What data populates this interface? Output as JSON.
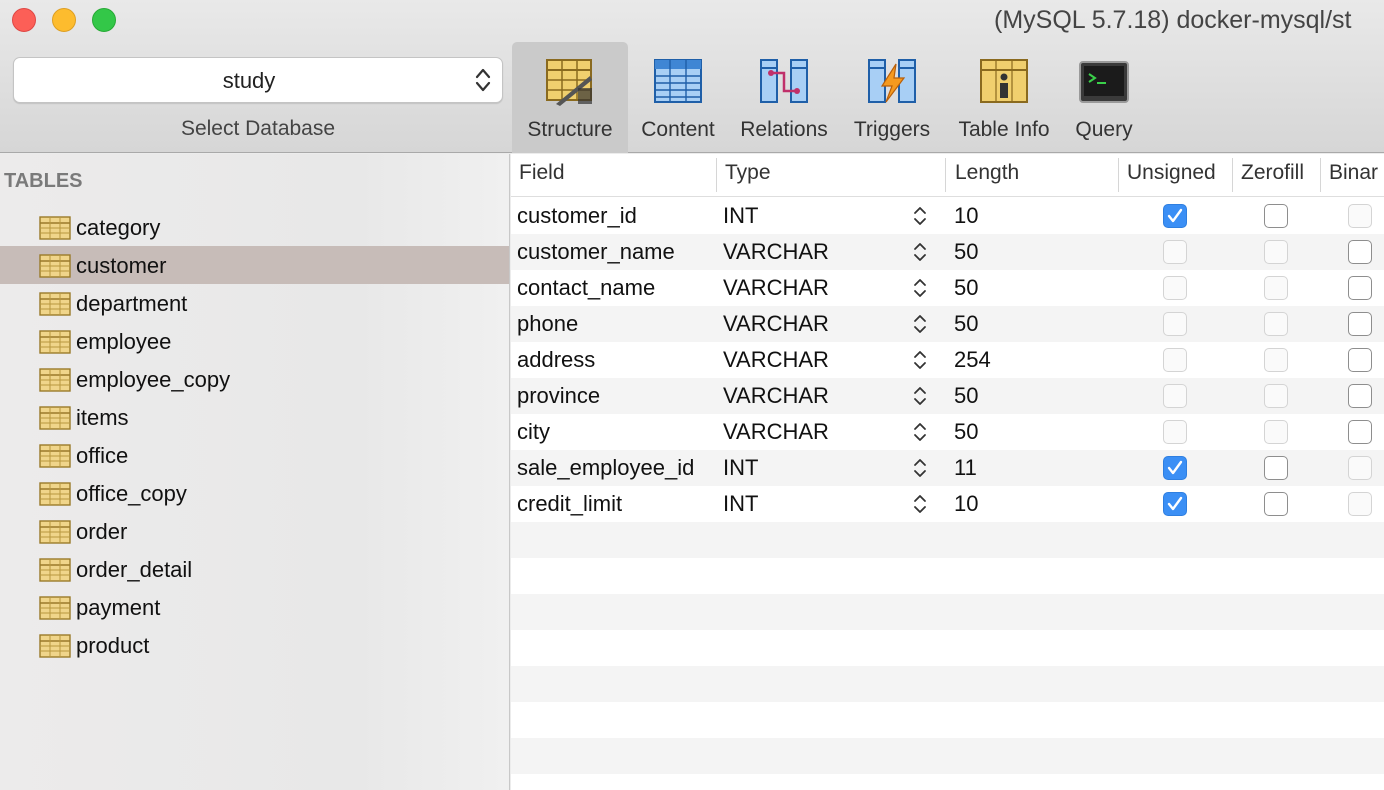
{
  "window": {
    "title": "(MySQL 5.7.18) docker-mysql/st"
  },
  "database": {
    "selected": "study",
    "label": "Select Database"
  },
  "toolbar": {
    "items": [
      {
        "label": "Structure",
        "icon": "structure-icon"
      },
      {
        "label": "Content",
        "icon": "content-icon"
      },
      {
        "label": "Relations",
        "icon": "relations-icon"
      },
      {
        "label": "Triggers",
        "icon": "triggers-icon"
      },
      {
        "label": "Table Info",
        "icon": "table-info-icon"
      },
      {
        "label": "Query",
        "icon": "query-icon"
      }
    ],
    "active": "Structure"
  },
  "sidebar": {
    "heading": "TABLES",
    "selected": "customer",
    "tables": [
      "category",
      "customer",
      "department",
      "employee",
      "employee_copy",
      "items",
      "office",
      "office_copy",
      "order",
      "order_detail",
      "payment",
      "product"
    ]
  },
  "structure": {
    "columns": [
      "Field",
      "Type",
      "Length",
      "Unsigned",
      "Zerofill",
      "Binar"
    ],
    "rows": [
      {
        "field": "customer_id",
        "type": "INT",
        "length": "10",
        "unsigned": true,
        "zerofill": false,
        "binary": false
      },
      {
        "field": "customer_name",
        "type": "VARCHAR",
        "length": "50",
        "unsigned": false,
        "zerofill": false,
        "binary": false
      },
      {
        "field": "contact_name",
        "type": "VARCHAR",
        "length": "50",
        "unsigned": false,
        "zerofill": false,
        "binary": false
      },
      {
        "field": "phone",
        "type": "VARCHAR",
        "length": "50",
        "unsigned": false,
        "zerofill": false,
        "binary": false
      },
      {
        "field": "address",
        "type": "VARCHAR",
        "length": "254",
        "unsigned": false,
        "zerofill": false,
        "binary": false
      },
      {
        "field": "province",
        "type": "VARCHAR",
        "length": "50",
        "unsigned": false,
        "zerofill": false,
        "binary": false
      },
      {
        "field": "city",
        "type": "VARCHAR",
        "length": "50",
        "unsigned": false,
        "zerofill": false,
        "binary": false
      },
      {
        "field": "sale_employee_id",
        "type": "INT",
        "length": "11",
        "unsigned": true,
        "zerofill": false,
        "binary": false
      },
      {
        "field": "credit_limit",
        "type": "INT",
        "length": "10",
        "unsigned": true,
        "zerofill": false,
        "binary": false
      }
    ]
  },
  "colors": {
    "accent": "#3b8ff5",
    "selection": "#c7bcb8"
  }
}
